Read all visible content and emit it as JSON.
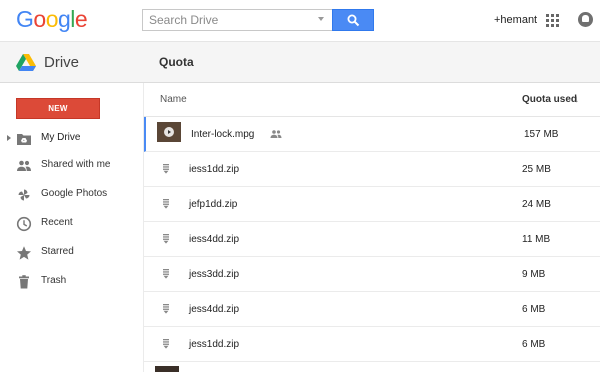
{
  "header": {
    "logo_letters": [
      {
        "ch": "G",
        "color": "#4285f4"
      },
      {
        "ch": "o",
        "color": "#ea4335"
      },
      {
        "ch": "o",
        "color": "#fbbc05"
      },
      {
        "ch": "g",
        "color": "#4285f4"
      },
      {
        "ch": "l",
        "color": "#34a853"
      },
      {
        "ch": "e",
        "color": "#ea4335"
      }
    ],
    "search_placeholder": "Search Drive",
    "search_value": "",
    "user": "+hemant",
    "apps_icon": "apps-grid-icon",
    "notifications_icon": "notifications-bell-icon"
  },
  "subbar": {
    "product": "Drive",
    "page_title": "Quota"
  },
  "sidebar": {
    "new_label": "NEW",
    "items": [
      {
        "label": "My Drive",
        "icon": "folder-drive-icon",
        "active": true
      },
      {
        "label": "Shared with me",
        "icon": "people-icon"
      },
      {
        "label": "Google Photos",
        "icon": "pinwheel-icon"
      },
      {
        "label": "Recent",
        "icon": "clock-icon"
      },
      {
        "label": "Starred",
        "icon": "star-icon"
      },
      {
        "label": "Trash",
        "icon": "trash-icon"
      }
    ]
  },
  "table": {
    "col_name": "Name",
    "col_quota": "Quota used",
    "sort_indicator": "↓",
    "rows": [
      {
        "name": "Inter-lock.mpg",
        "size": "157 MB",
        "type": "video",
        "shared": true
      },
      {
        "name": "iess1dd.zip",
        "size": "25 MB",
        "type": "zip"
      },
      {
        "name": "jefp1dd.zip",
        "size": "24 MB",
        "type": "zip"
      },
      {
        "name": "iess4dd.zip",
        "size": "11 MB",
        "type": "zip"
      },
      {
        "name": "jess3dd.zip",
        "size": "9 MB",
        "type": "zip"
      },
      {
        "name": "jess4dd.zip",
        "size": "6 MB",
        "type": "zip"
      },
      {
        "name": "jess1dd.zip",
        "size": "6 MB",
        "type": "zip"
      }
    ]
  },
  "colors": {
    "accent_blue": "#4a8af4",
    "new_button_red": "#dc4a38"
  }
}
